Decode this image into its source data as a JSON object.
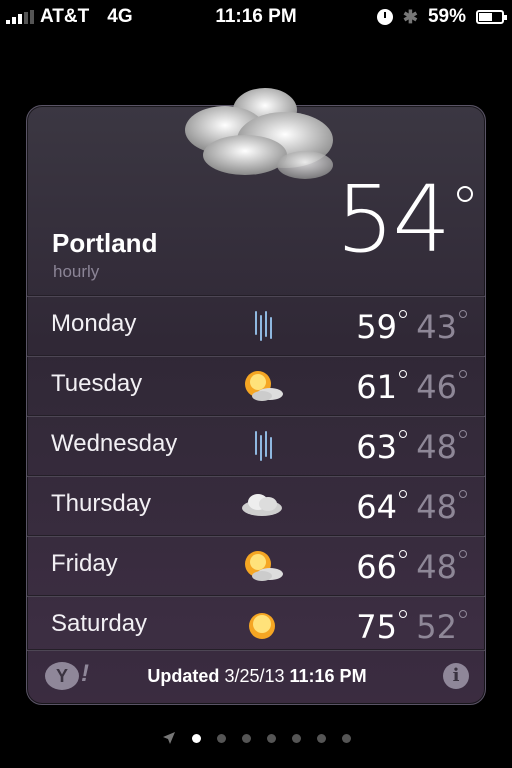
{
  "status": {
    "carrier": "AT&T",
    "network": "4G",
    "time": "11:16 PM",
    "battery": "59%",
    "battery_level": 0.59,
    "signal_bars_on": 3,
    "signal_bars_total": 5
  },
  "weather": {
    "city": "Portland",
    "subtitle": "hourly",
    "current_temp": "54",
    "forecast": [
      {
        "day": "Monday",
        "icon": "rain-icon",
        "high": "59",
        "low": "43"
      },
      {
        "day": "Tuesday",
        "icon": "partly-sunny-icon",
        "high": "61",
        "low": "46"
      },
      {
        "day": "Wednesday",
        "icon": "rain-icon",
        "high": "63",
        "low": "48"
      },
      {
        "day": "Thursday",
        "icon": "cloud-icon",
        "high": "64",
        "low": "48"
      },
      {
        "day": "Friday",
        "icon": "partly-sunny-icon",
        "high": "66",
        "low": "48"
      },
      {
        "day": "Saturday",
        "icon": "sunny-icon",
        "high": "75",
        "low": "52"
      }
    ],
    "footer": {
      "updated_label": "Updated",
      "date": "3/25/13",
      "time": "11:16 PM"
    }
  },
  "pager": {
    "total_pages": 7,
    "active_page": 1
  },
  "colors": {
    "card_bg": "#3b3742",
    "low_temp": "#8e8797",
    "sun": "#f5a623"
  }
}
